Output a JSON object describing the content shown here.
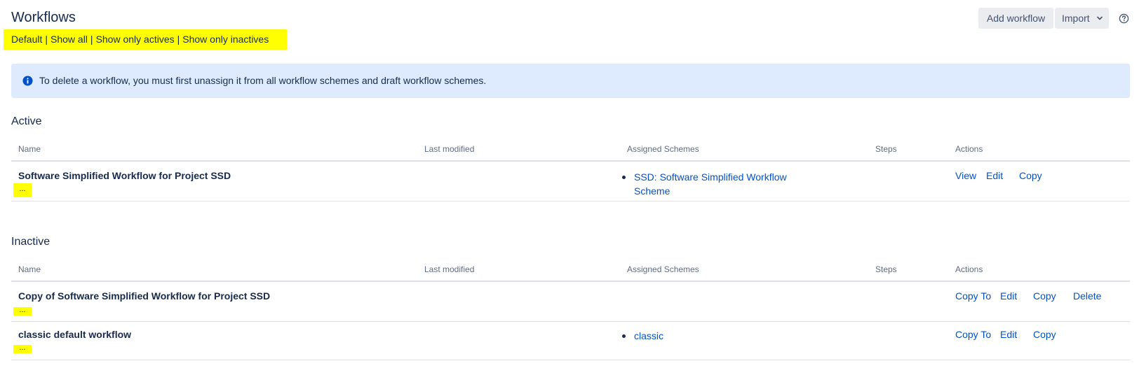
{
  "header": {
    "title": "Workflows",
    "add_workflow_label": "Add workflow",
    "import_label": "Import"
  },
  "filters": {
    "items": [
      "Default",
      "Show all",
      "Show only actives",
      "Show only inactives"
    ],
    "separator": "|"
  },
  "info_banner": {
    "text": "To delete a workflow, you must first unassign it from all workflow schemes and draft workflow schemes."
  },
  "columns": {
    "name": "Name",
    "last_modified": "Last modified",
    "assigned_schemes": "Assigned Schemes",
    "steps": "Steps",
    "actions": "Actions"
  },
  "active": {
    "heading": "Active",
    "rows": [
      {
        "name": "Software Simplified Workflow for Project SSD",
        "more": "...",
        "schemes": [
          {
            "line1": "SSD: Software Simplified Workflow",
            "line2": "Scheme"
          }
        ],
        "actions": [
          "View",
          "Edit",
          "Copy"
        ]
      }
    ]
  },
  "inactive": {
    "heading": "Inactive",
    "rows": [
      {
        "name": "Copy of Software Simplified Workflow for Project SSD",
        "more": "...",
        "schemes": [],
        "actions": [
          "Copy To",
          "Edit",
          "Copy",
          "Delete"
        ]
      },
      {
        "name": "classic default workflow",
        "more": "...",
        "schemes": [
          {
            "line1": "classic"
          }
        ],
        "actions": [
          "Copy To",
          "Edit",
          "Copy"
        ]
      }
    ]
  },
  "colors": {
    "highlight": "#ffff00",
    "link": "#0052cc",
    "banner_bg": "#deebff",
    "info_icon": "#0052cc",
    "button_bg": "#ebecf0"
  },
  "icons": {
    "help": "help-icon",
    "info": "info-icon",
    "import_chevron": "chevron-down-icon"
  }
}
